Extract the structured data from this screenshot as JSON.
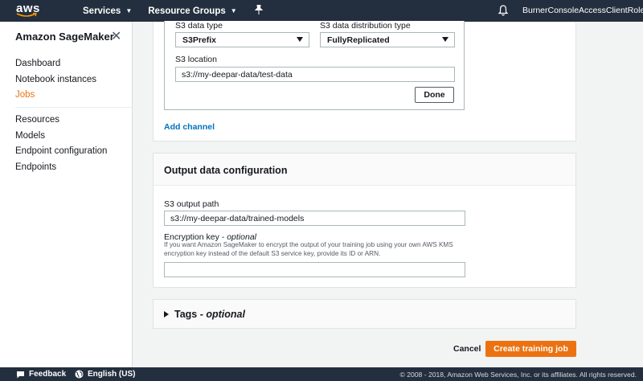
{
  "topnav": {
    "logo": "aws",
    "services": "Services",
    "resource_groups": "Resource Groups",
    "pin_icon": "pin-icon",
    "bell_icon": "bell-icon",
    "account": "BurnerConsoleAccessClientRole..."
  },
  "sidebar": {
    "title": "Amazon SageMaker",
    "items": [
      "Dashboard",
      "Notebook instances",
      "Jobs",
      "Resources",
      "Models",
      "Endpoint configuration",
      "Endpoints"
    ],
    "active": "Jobs"
  },
  "channel": {
    "s3_data_type_label": "S3 data type",
    "s3_data_type_value": "S3Prefix",
    "distribution_label": "S3 data distribution type",
    "distribution_value": "FullyReplicated",
    "s3_location_label": "S3 location",
    "s3_location_value": "s3://my-deepar-data/test-data",
    "done_label": "Done",
    "add_channel": "Add channel"
  },
  "output": {
    "title": "Output data configuration",
    "s3_output_label": "S3 output path",
    "s3_output_value": "s3://my-deepar-data/trained-models",
    "encryption_label": "Encryption key",
    "encryption_optional": " - optional",
    "encryption_help": "If you want Amazon SageMaker to encrypt the output of your training job using your own AWS KMS encryption key instead of the default S3 service key, provide its ID or ARN.",
    "encryption_value": ""
  },
  "tags": {
    "label": "Tags",
    "optional": " - optional"
  },
  "actions": {
    "cancel": "Cancel",
    "create": "Create training job"
  },
  "footer": {
    "feedback": "Feedback",
    "language": "English (US)",
    "copyright": "© 2008 - 2018, Amazon Web Services, Inc. or its affiliates. All rights reserved."
  },
  "colors": {
    "nav_bg": "#232f3e",
    "accent": "#ec7211",
    "link": "#0073bb"
  }
}
